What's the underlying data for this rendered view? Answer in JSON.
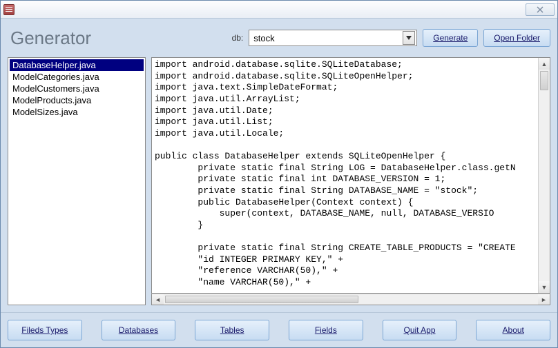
{
  "titlebar": {},
  "header": {
    "title": "Generator",
    "db_label": "db:",
    "db_value": "stock",
    "generate_label": "Generate",
    "open_folder_label": "Open Folder"
  },
  "files": {
    "items": [
      {
        "name": "DatabaseHelper.java",
        "selected": true
      },
      {
        "name": "ModelCategories.java",
        "selected": false
      },
      {
        "name": "ModelCustomers.java",
        "selected": false
      },
      {
        "name": "ModelProducts.java",
        "selected": false
      },
      {
        "name": "ModelSizes.java",
        "selected": false
      }
    ]
  },
  "code": {
    "text": "import android.database.sqlite.SQLiteDatabase;\nimport android.database.sqlite.SQLiteOpenHelper;\nimport java.text.SimpleDateFormat;\nimport java.util.ArrayList;\nimport java.util.Date;\nimport java.util.List;\nimport java.util.Locale;\n\npublic class DatabaseHelper extends SQLiteOpenHelper {\n        private static final String LOG = DatabaseHelper.class.getN\n        private static final int DATABASE_VERSION = 1;\n        private static final String DATABASE_NAME = \"stock\";\n        public DatabaseHelper(Context context) {\n            super(context, DATABASE_NAME, null, DATABASE_VERSIO\n        }\n\n        private static final String CREATE_TABLE_PRODUCTS = \"CREATE\n        \"id INTEGER PRIMARY KEY,\" +\n        \"reference VARCHAR(50),\" +\n        \"name VARCHAR(50),\" +"
  },
  "bottom": {
    "buttons": [
      "Fileds Types",
      "Databases",
      "Tables",
      "Fields",
      "Quit App",
      "About"
    ]
  }
}
